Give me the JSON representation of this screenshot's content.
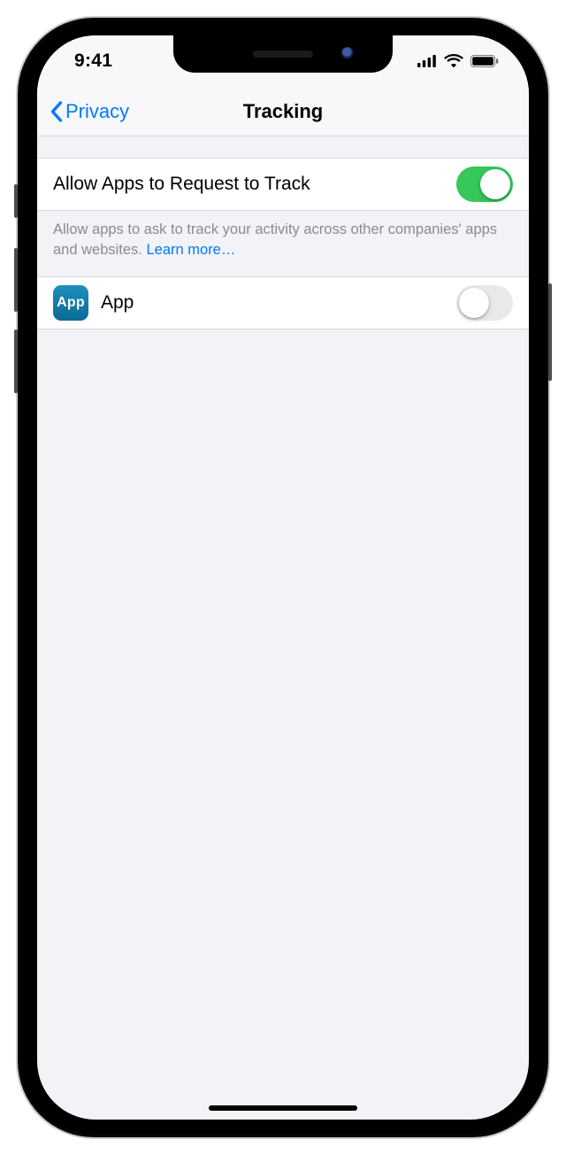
{
  "status": {
    "time": "9:41"
  },
  "nav": {
    "back_label": "Privacy",
    "title": "Tracking"
  },
  "settings": {
    "allow_request": {
      "label": "Allow Apps to Request to Track",
      "on": true
    },
    "footer_text": "Allow apps to ask to track your activity across other companies' apps and websites. ",
    "learn_more": "Learn more…",
    "app_row": {
      "icon_text": "App",
      "label": "App",
      "on": false
    }
  }
}
